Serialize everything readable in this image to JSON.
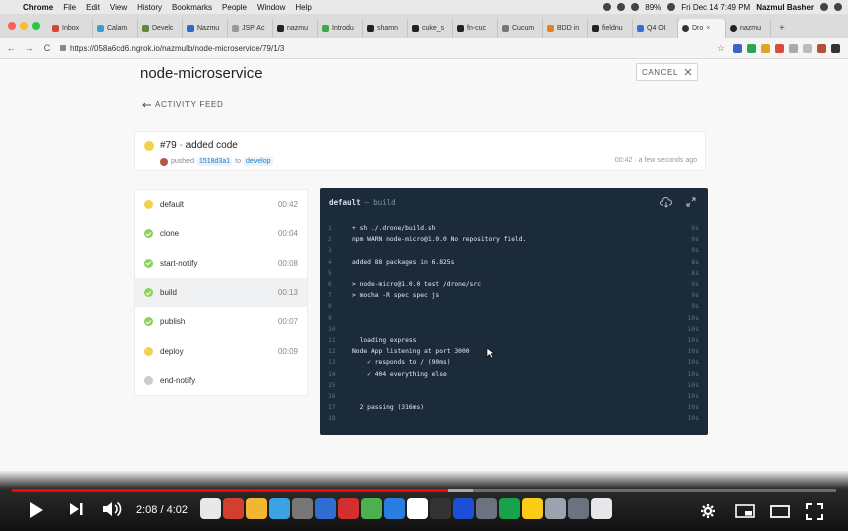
{
  "menubar": {
    "app_name": "Chrome",
    "menus": [
      "File",
      "Edit",
      "View",
      "History",
      "Bookmarks",
      "People",
      "Window",
      "Help"
    ],
    "battery": "89%",
    "datetime": "Fri Dec 14  7:49 PM",
    "user": "Nazmul Basher"
  },
  "tabs": [
    {
      "label": "Inbox",
      "color": "#d44638"
    },
    {
      "label": "Calam",
      "color": "#37a0c8"
    },
    {
      "label": "Develc",
      "color": "#5a8a3a"
    },
    {
      "label": "Nazmu",
      "color": "#2a6acb"
    },
    {
      "label": "JSP Ac",
      "color": "#999999"
    },
    {
      "label": "nazmu",
      "color": "#222222"
    },
    {
      "label": "Introdu",
      "color": "#46a546"
    },
    {
      "label": "shamn",
      "color": "#222222"
    },
    {
      "label": "cuke_s",
      "color": "#222222"
    },
    {
      "label": "fn-cuc",
      "color": "#222222"
    },
    {
      "label": "Cucum",
      "color": "#777777"
    },
    {
      "label": "BDD in",
      "color": "#e67e22"
    },
    {
      "label": "fieldnu",
      "color": "#222222"
    },
    {
      "label": "Q4 OI",
      "color": "#3a6bd6"
    }
  ],
  "active_tab": {
    "label": "Dro",
    "close": "×"
  },
  "last_tab": {
    "label": "nazmu"
  },
  "new_tab": "+",
  "address": {
    "url": "https://058a6cd6.ngrok.io/nazmulb/node-microservice/79/1/3"
  },
  "extensions": [
    "#3b62c4",
    "#2da44e",
    "#e0a42a",
    "#d94c3d",
    "#aaaaaa",
    "#bbbbbb",
    "#b0522f",
    "#333333"
  ],
  "page": {
    "title": "node-microservice",
    "cancel_label": "CANCEL",
    "back_label": "ACTIVITY FEED"
  },
  "build": {
    "number_title": "#79",
    "separator": " - ",
    "message": "added code",
    "pushed_label": "pushed",
    "commit": "1518d3a1",
    "to_label": "to",
    "branch": "develop",
    "duration": "00:42",
    "ago": "a few seconds ago",
    "status_color": "#f3d14c"
  },
  "steps": [
    {
      "name": "default",
      "duration": "00:42",
      "status": "running",
      "color": "#f3d14c"
    },
    {
      "name": "clone",
      "duration": "00:04",
      "status": "success",
      "color": "#8ed25a"
    },
    {
      "name": "start-notify",
      "duration": "00:08",
      "status": "success",
      "color": "#8ed25a"
    },
    {
      "name": "build",
      "duration": "00:13",
      "status": "success",
      "color": "#8ed25a"
    },
    {
      "name": "publish",
      "duration": "00:07",
      "status": "success",
      "color": "#8ed25a"
    },
    {
      "name": "deploy",
      "duration": "00:09",
      "status": "running",
      "color": "#f3d14c"
    },
    {
      "name": "end-notify",
      "duration": "",
      "status": "pending",
      "color": "#cccccc"
    }
  ],
  "console": {
    "step": "default",
    "dash": "—",
    "subtitle": "build",
    "lines": [
      {
        "n": "1",
        "text": "+ sh ./.drone/build.sh",
        "t": "0s"
      },
      {
        "n": "2",
        "text": "npm WARN node-micro@1.0.0 No repository field.",
        "t": "0s"
      },
      {
        "n": "3",
        "text": "",
        "t": "0s"
      },
      {
        "n": "4",
        "text": "added 88 packages in 6.825s",
        "t": "8s"
      },
      {
        "n": "5",
        "text": "",
        "t": "8s"
      },
      {
        "n": "6",
        "text": "> node-micro@1.0.0 test /drone/src",
        "t": "9s"
      },
      {
        "n": "7",
        "text": "> mocha -R spec spec js",
        "t": "9s"
      },
      {
        "n": "8",
        "text": "",
        "t": "9s"
      },
      {
        "n": "9",
        "text": "",
        "t": "10s"
      },
      {
        "n": "10",
        "text": "",
        "t": "10s"
      },
      {
        "n": "11",
        "text": "  loading express",
        "t": "10s"
      },
      {
        "n": "12",
        "text": "Node App listening at port 3000",
        "t": "10s"
      },
      {
        "n": "13",
        "text": "    ✓ responds to / (90ms)",
        "t": "10s"
      },
      {
        "n": "14",
        "text": "    ✓ 404 everything else",
        "t": "10s"
      },
      {
        "n": "15",
        "text": "",
        "t": "10s"
      },
      {
        "n": "16",
        "text": "",
        "t": "10s"
      },
      {
        "n": "17",
        "text": "  2 passing (316ms)",
        "t": "10s"
      },
      {
        "n": "18",
        "text": "",
        "t": "10s"
      }
    ]
  },
  "player": {
    "time": "2:08 / 4:02",
    "played_fraction": 0.529,
    "buffered_fraction": 0.56
  },
  "dock_colors": [
    "#e8e8e8",
    "#d33f2f",
    "#f2b632",
    "#3aa3e3",
    "#777777",
    "#2f6dd1",
    "#d32f2f",
    "#4caf50",
    "#2a7de1",
    "#ffffff",
    "#333333",
    "#1d4ed8",
    "#6b7280",
    "#16a34a",
    "#facc15",
    "#9ca3af",
    "#6b7280",
    "#e5e7eb"
  ]
}
